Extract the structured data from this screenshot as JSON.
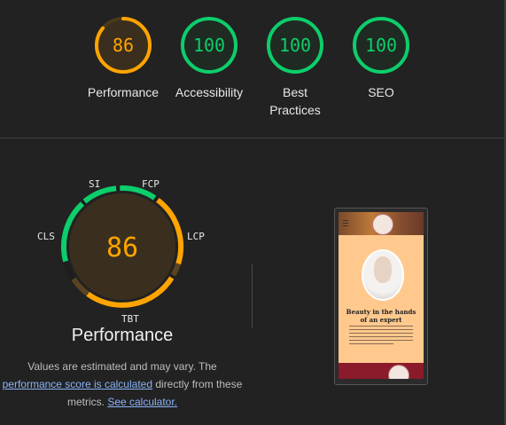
{
  "categories": [
    {
      "label": "Performance",
      "score": "86",
      "level": 0.86,
      "color": "#ffa400",
      "ring_bg": "#4a3a1a",
      "fill": "#3a2f1e"
    },
    {
      "label": "Accessibility",
      "score": "100",
      "level": 1.0,
      "color": "#0cce6b",
      "ring_bg": "#1d3d2a",
      "fill": "#1f2a22"
    },
    {
      "label_line1": "Best",
      "label_line2": "Practices",
      "score": "100",
      "level": 1.0,
      "color": "#0cce6b",
      "ring_bg": "#1d3d2a",
      "fill": "#1f2a22"
    },
    {
      "label": "SEO",
      "score": "100",
      "level": 1.0,
      "color": "#0cce6b",
      "ring_bg": "#1d3d2a",
      "fill": "#1f2a22"
    }
  ],
  "performance": {
    "score": "86",
    "title": "Performance",
    "metrics": {
      "si": "SI",
      "fcp": "FCP",
      "lcp": "LCP",
      "tbt": "TBT",
      "cls": "CLS"
    },
    "note_1": "Values are estimated and may vary. The",
    "note_link_1": "performance score is calculated",
    "note_2": " directly from these",
    "note_3": "metrics. ",
    "note_link_2": "See calculator.",
    "colors": {
      "good": "#0cce6b",
      "average": "#ffa400",
      "dim": "#5a4322",
      "center": "#3a2f1e"
    }
  },
  "preview": {
    "heading_line1": "Beauty in the hands",
    "heading_line2": "of an expert"
  }
}
